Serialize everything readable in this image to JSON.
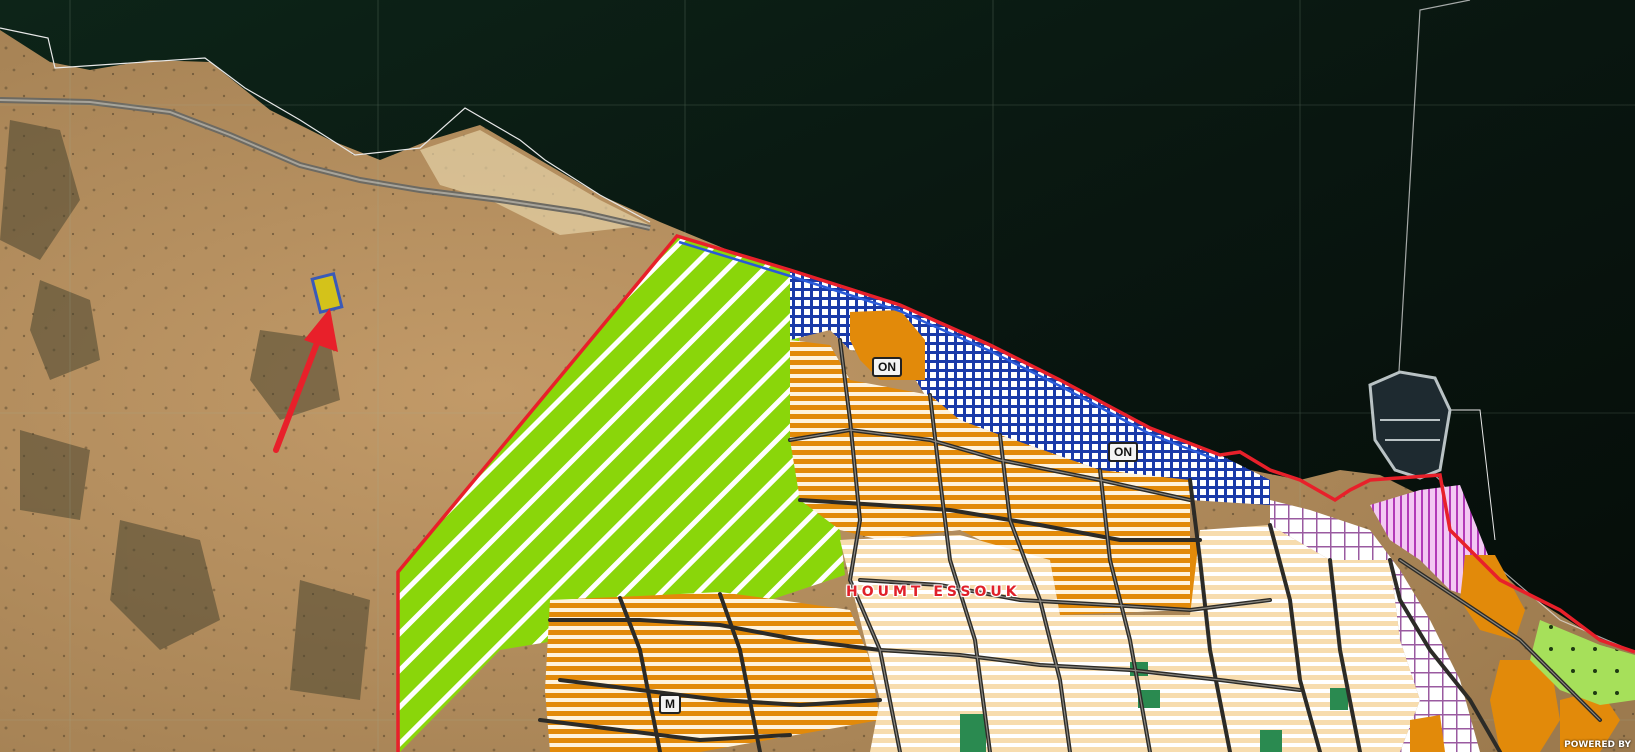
{
  "map": {
    "place_label": "HOUMT ESSOUK",
    "zone_labels": [
      "ON",
      "ON",
      "M"
    ],
    "attribution": "POWERED BY",
    "colors": {
      "sea": "#0b1a12",
      "land": "#b08a5a",
      "boundary": "#e8202a",
      "coast_hatch": "#1a3aa8",
      "green_zone": "#8ad60a",
      "orange_zone": "#e28a0a",
      "light_zone": "#f7dcae",
      "pink_zone": "#e8b8e8",
      "roads": "#3a3a3a",
      "parcel_marker": "#d4c21a",
      "arrow": "#e8202a"
    }
  }
}
